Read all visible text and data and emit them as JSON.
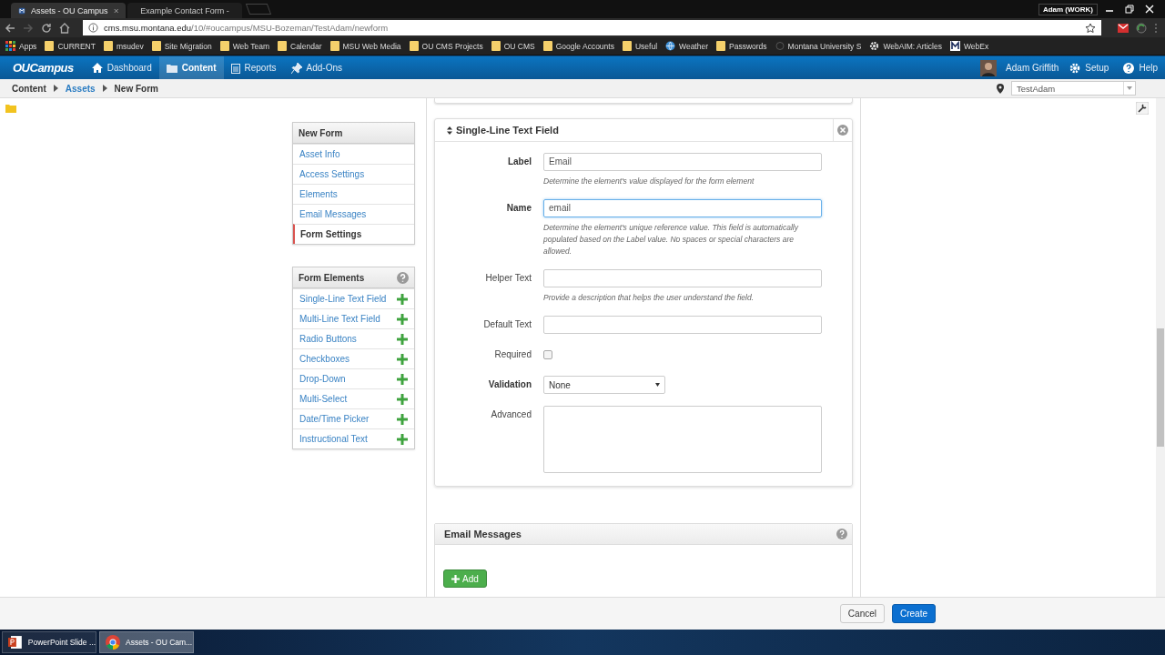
{
  "browser": {
    "tabs": [
      {
        "title": "Assets - OU Campus",
        "selected": true
      },
      {
        "title": "Example Contact Form -",
        "selected": false
      }
    ],
    "profile": "Adam (WORK)",
    "url": {
      "host": "cms.msu.montana.edu",
      "path": "/10/#oucampus/MSU-Bozeman/TestAdam/newform"
    },
    "bookmarks": [
      {
        "label": "Apps",
        "kind": "apps"
      },
      {
        "label": "CURRENT",
        "kind": "folder"
      },
      {
        "label": "msudev",
        "kind": "folder"
      },
      {
        "label": "Site Migration",
        "kind": "folder"
      },
      {
        "label": "Web Team",
        "kind": "folder"
      },
      {
        "label": "Calendar",
        "kind": "folder"
      },
      {
        "label": "MSU Web Media",
        "kind": "folder"
      },
      {
        "label": "OU CMS Projects",
        "kind": "folder"
      },
      {
        "label": "OU CMS",
        "kind": "folder"
      },
      {
        "label": "Google Accounts",
        "kind": "folder"
      },
      {
        "label": "Useful",
        "kind": "folder"
      },
      {
        "label": "Weather",
        "kind": "globe"
      },
      {
        "label": "Passwords",
        "kind": "folder"
      },
      {
        "label": "Montana University S",
        "kind": "site"
      },
      {
        "label": "WebAIM: Articles",
        "kind": "gear"
      },
      {
        "label": "WebEx",
        "kind": "m"
      }
    ]
  },
  "app": {
    "logo": "OUCampus",
    "nav": [
      {
        "label": "Dashboard",
        "selected": false
      },
      {
        "label": "Content",
        "selected": true
      },
      {
        "label": "Reports",
        "selected": false
      },
      {
        "label": "Add-Ons",
        "selected": false
      }
    ],
    "user": "Adam Griffith",
    "setup": "Setup",
    "help": "Help"
  },
  "breadcrumb": [
    {
      "label": "Content",
      "link": false
    },
    {
      "label": "Assets",
      "link": true
    },
    {
      "label": "New Form",
      "link": false
    }
  ],
  "site_selector": "TestAdam",
  "sections": {
    "title": "New Form",
    "items": [
      {
        "label": "Asset Info",
        "selected": false
      },
      {
        "label": "Access Settings",
        "selected": false
      },
      {
        "label": "Elements",
        "selected": false
      },
      {
        "label": "Email Messages",
        "selected": false
      },
      {
        "label": "Form Settings",
        "selected": true
      }
    ]
  },
  "form_elements": {
    "title": "Form Elements",
    "items": [
      "Single-Line Text Field",
      "Multi-Line Text Field",
      "Radio Buttons",
      "Checkboxes",
      "Drop-Down",
      "Multi-Select",
      "Date/Time Picker",
      "Instructional Text"
    ]
  },
  "element_editor": {
    "title": "Single-Line Text Field",
    "fields": [
      {
        "label": "Label",
        "kind": "text",
        "emphasis": true,
        "value": "Email",
        "focused": false,
        "hint": "Determine the element's value displayed for the form element"
      },
      {
        "label": "Name",
        "kind": "text",
        "emphasis": true,
        "value": "email",
        "focused": true,
        "hint": "Determine the element's unique reference value. This field is automatically populated based on the Label value. No spaces or special characters are allowed."
      },
      {
        "label": "Helper Text",
        "kind": "text",
        "emphasis": false,
        "focused": false,
        "hint": "Provide a description that helps the user understand the field."
      },
      {
        "label": "Default Text",
        "kind": "text",
        "emphasis": false,
        "focused": false
      },
      {
        "label": "Required",
        "kind": "checkbox",
        "emphasis": false,
        "checked": false
      },
      {
        "label": "Validation",
        "kind": "select",
        "emphasis": true,
        "value": "None"
      },
      {
        "label": "Advanced",
        "kind": "textarea",
        "emphasis": false
      }
    ]
  },
  "email_messages": {
    "title": "Email Messages",
    "add_button": "Add"
  },
  "footer": {
    "cancel": "Cancel",
    "create": "Create"
  },
  "taskbar": [
    {
      "label": "PowerPoint Slide ...",
      "selected": false
    },
    {
      "label": "Assets - OU Cam...",
      "selected": true
    }
  ]
}
